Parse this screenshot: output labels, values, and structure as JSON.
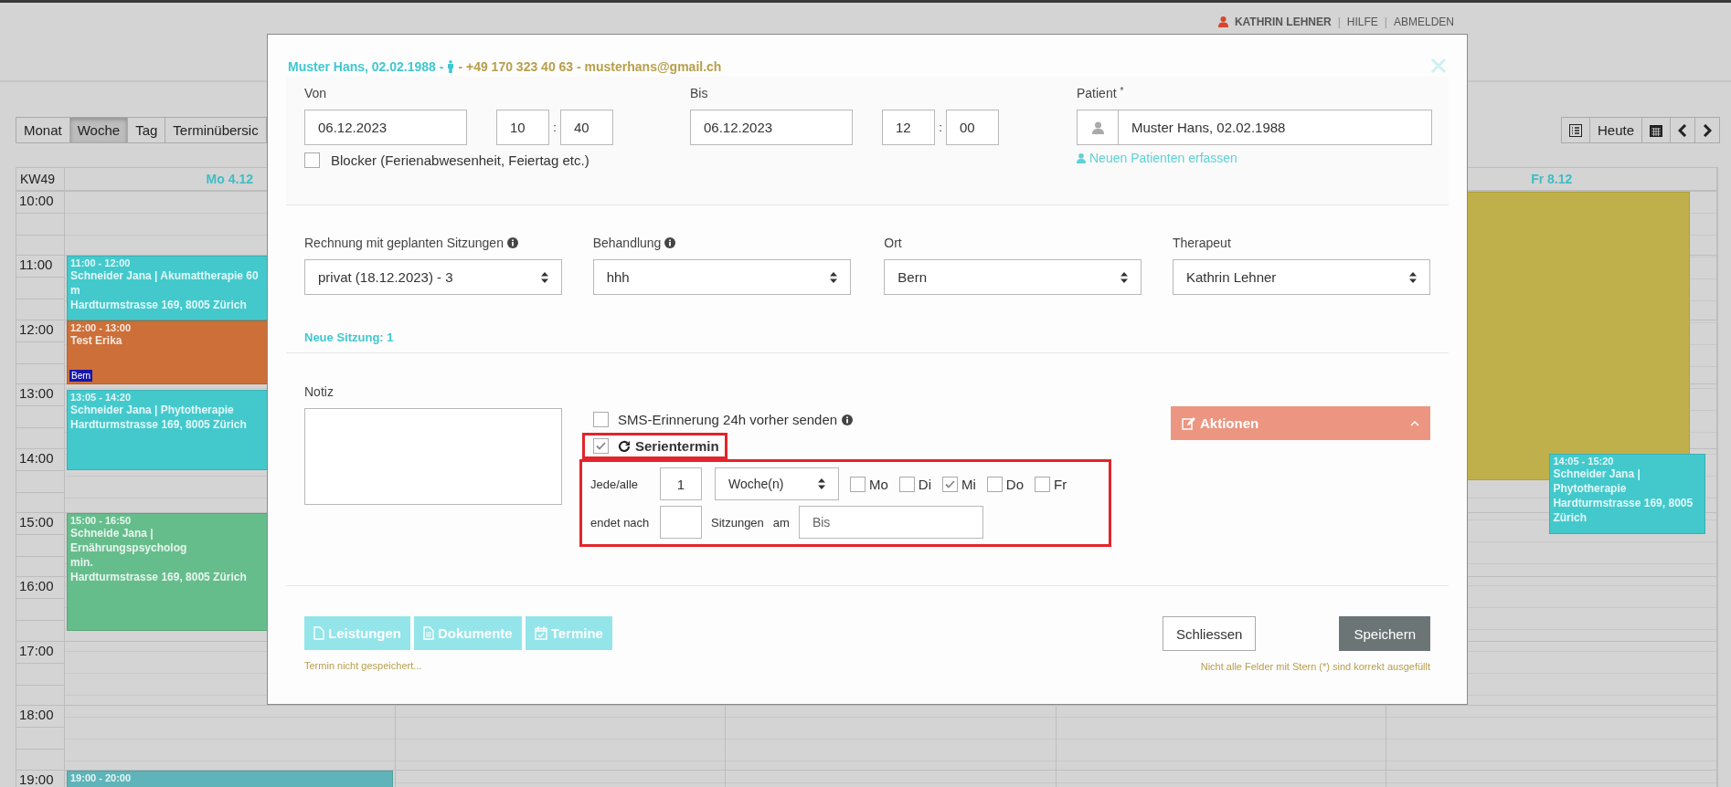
{
  "header": {
    "user": "KATHRIN LEHNER",
    "separator": "|",
    "links": [
      "HILFE",
      "ABMELDEN"
    ]
  },
  "view_tabs": [
    {
      "label": "Monat",
      "selected": false
    },
    {
      "label": "Woche",
      "selected": true
    },
    {
      "label": "Tag",
      "selected": false
    },
    {
      "label": "Terminübersic",
      "selected": false
    }
  ],
  "today_button": "Heute",
  "calendar": {
    "week": "KW49",
    "hours": [
      "10:00",
      "11:00",
      "12:00",
      "13:00",
      "14:00",
      "15:00",
      "16:00",
      "17:00",
      "18:00",
      "19:00"
    ],
    "days": [
      {
        "label": "Mo 4.12",
        "events": [
          {
            "time": "11:00 - 12:00",
            "lines": [
              "Schneider Jana | Akumattherapie 60 m",
              "Hardturmstrasse 169, 8005 Zürich"
            ],
            "color": "#43c9cc",
            "kind": "full"
          },
          {
            "time": "12:00 - 13:00",
            "lines": [
              "Test Erika"
            ],
            "badge": "Bern",
            "color": "#cc6f38",
            "kind": "full"
          },
          {
            "time": "13:05 - 14:20",
            "lines": [
              "Schneider Jana | Phytotherapie",
              "Hardturmstrasse 169, 8005 Zürich"
            ],
            "color": "#43c9cc",
            "kind": "full"
          },
          {
            "time": "15:00 - 16:50",
            "lines": [
              "Schneide Jana | Ernährungspsycholog",
              "min.",
              "Hardturmstrasse 169, 8005 Zürich"
            ],
            "color": "#66bd8c",
            "kind": "full"
          },
          {
            "time": "19:00 - 20:00",
            "color": "#5fb4b9",
            "kind": "full"
          }
        ]
      },
      {
        "label": "Fr 8.12",
        "events": [
          {
            "time": "14:05 - 15:20",
            "lines": [
              "Schneider Jana | Phytotherapie",
              "Hardturmstrasse 169, 8005 Zürich"
            ],
            "color": "#43c9cc",
            "kind": "side"
          }
        ]
      }
    ]
  },
  "dialog": {
    "summary": [
      "Muster Hans, 02.02.1988 -",
      "- +49 170 323 40 63 - musterhans@gmail.ch"
    ],
    "from": {
      "label": "Von",
      "date": "06.12.2023",
      "hour": "10",
      "minute": "40",
      "separator": ":"
    },
    "to": {
      "label": "Bis",
      "date": "06.12.2023",
      "hour": "12",
      "minute": "00",
      "separator": ":"
    },
    "blocker": {
      "label": "Blocker (Ferienabwesenheit, Feiertag etc.)",
      "checked": false
    },
    "patient": {
      "label": "Patient",
      "required_mark": "*",
      "value": "Muster Hans, 02.02.1988",
      "link": "Neuen Patienten erfassen"
    },
    "selects": [
      {
        "label": "Rechnung mit geplanten Sitzungen",
        "info": true,
        "value": "privat (18.12.2023) - 3"
      },
      {
        "label": "Behandlung",
        "info": true,
        "value": "hhh"
      },
      {
        "label": "Ort",
        "info": false,
        "value": "Bern"
      },
      {
        "label": "Therapeut",
        "info": false,
        "value": "Kathrin Lehner"
      }
    ],
    "new_session": "Neue Sitzung: 1",
    "note_label": "Notiz",
    "options": [
      {
        "label": "SMS-Erinnerung 24h vorher senden",
        "checked": false,
        "kind": "info",
        "highlighted": false
      },
      {
        "label": "Serientermin",
        "checked": true,
        "kind": "repeat",
        "highlighted": true
      }
    ],
    "series": {
      "highlighted": true,
      "every_label": "Jede/alle",
      "every_value": "1",
      "unit": "Woche(n)",
      "weekdays": [
        {
          "label": "Mo",
          "checked": false
        },
        {
          "label": "Di",
          "checked": false
        },
        {
          "label": "Mi",
          "checked": true
        },
        {
          "label": "Do",
          "checked": false
        },
        {
          "label": "Fr",
          "checked": false
        }
      ],
      "ends_label": "endet nach",
      "sessions_label": "Sitzungen",
      "on_label": "am",
      "until_placeholder": "Bis"
    },
    "actions_button": "Aktionen",
    "footer_buttons": [
      {
        "label": "Leistungen",
        "kind": "file"
      },
      {
        "label": "Dokumente",
        "kind": "file-text"
      },
      {
        "label": "Termine",
        "kind": "calendar"
      }
    ],
    "status": "Termin nicht gespeichert...",
    "close_button": "Schliessen",
    "save_button": "Speichern",
    "validation": "Nicht alle Felder mit Stern (*) sind korrekt ausgefüllt"
  }
}
